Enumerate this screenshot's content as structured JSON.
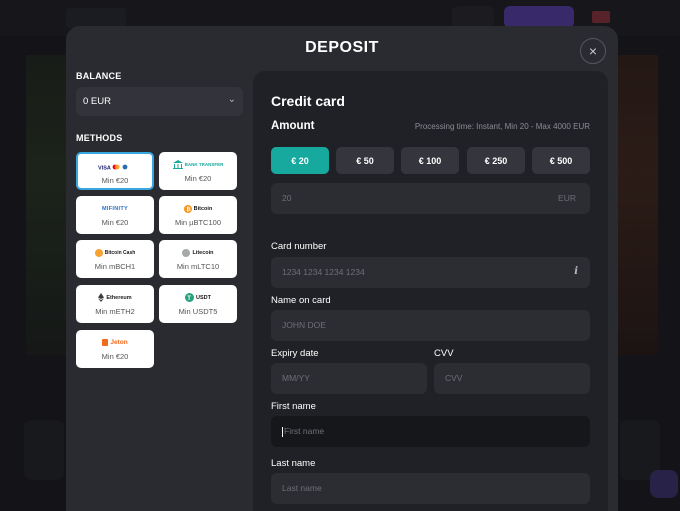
{
  "modal": {
    "title": "DEPOSIT",
    "close_icon": "×"
  },
  "sidebar": {
    "balance_label": "BALANCE",
    "balance_value": "0 EUR",
    "methods_label": "METHODS",
    "methods": [
      {
        "name": "VISA ● ● ",
        "min": "Min €20",
        "selected": true
      },
      {
        "name": "BANK TRANSFER",
        "min": "Min €20"
      },
      {
        "name": "MIFINITY",
        "min": "Min €20"
      },
      {
        "name": "Bitcoin",
        "min": "Min µBTC100"
      },
      {
        "name": "Bitcoin Cash",
        "min": "Min mBCH1"
      },
      {
        "name": "Litecoin",
        "min": "Min mLTC10"
      },
      {
        "name": "Ethereum",
        "min": "Min mETH2"
      },
      {
        "name": "USDT",
        "min": "Min USDT5"
      },
      {
        "name": "Jeton",
        "min": "Min €20"
      }
    ]
  },
  "form": {
    "title": "Credit card",
    "amount_label": "Amount",
    "processing_time": "Processing time: Instant, Min 20 - Max 4000 EUR",
    "amounts": [
      "€ 20",
      "€ 50",
      "€ 100",
      "€ 250",
      "€ 500"
    ],
    "amount_value": "20",
    "currency": "EUR",
    "card_number_label": "Card number",
    "card_number_placeholder": "1234 1234 1234 1234",
    "info_icon": "i",
    "name_on_card_label": "Name on card",
    "name_on_card_placeholder": "JOHN DOE",
    "expiry_label": "Expiry date",
    "expiry_placeholder": "MM/YY",
    "cvv_label": "CVV",
    "cvv_placeholder": "CVV",
    "first_name_label": "First name",
    "first_name_placeholder": "First name",
    "last_name_label": "Last name",
    "last_name_placeholder": "Last name"
  },
  "colors": {
    "accent": "#17a89e",
    "selected_border": "#3aa6e0",
    "panel": "#202126",
    "modal": "#2a2b31"
  }
}
